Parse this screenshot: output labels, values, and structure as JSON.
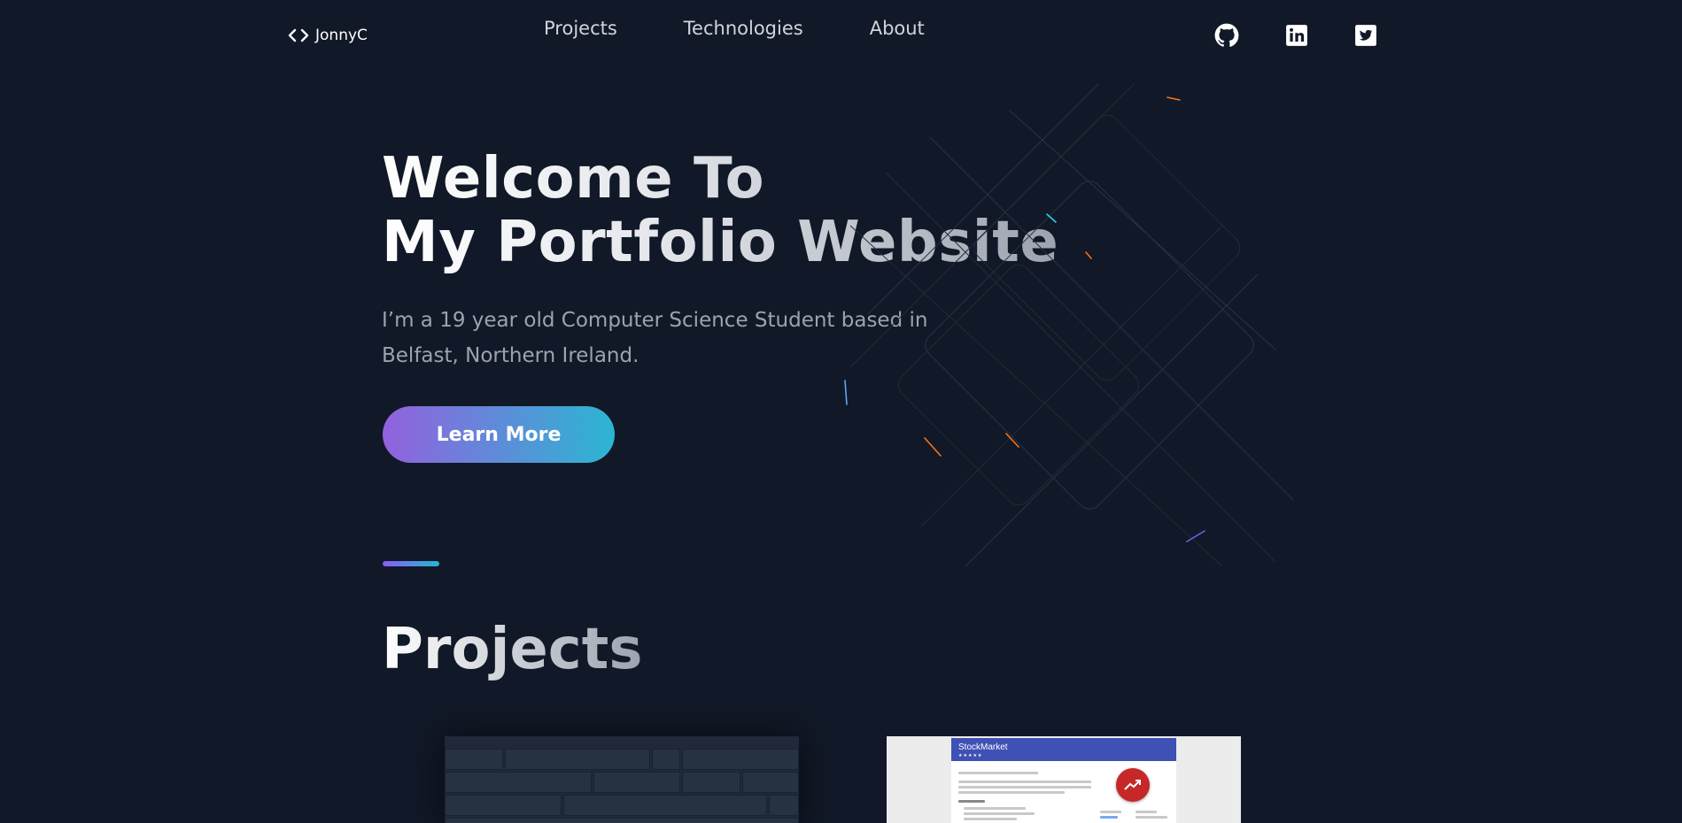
{
  "nav": {
    "logo_text": "JonnyC",
    "links": [
      "Projects",
      "Technologies",
      "About"
    ],
    "social_icons": [
      "github-icon",
      "linkedin-icon",
      "twitter-icon"
    ]
  },
  "hero": {
    "title_line1": "Welcome To",
    "title_line2": "My Portfolio Website",
    "subtitle": "I’m a 19 year old Computer Science Student based in Belfast, Northern Ireland.",
    "button_label": "Learn More"
  },
  "projects": {
    "heading": "Projects",
    "cards": [
      {
        "thumbnail": "keyboard-screenshot"
      },
      {
        "thumbnail": "stockmarket-screenshot",
        "app_title": "StockMarket"
      }
    ]
  },
  "colors": {
    "background": "#111827",
    "accent_start": "#9361de",
    "accent_end": "#2bb6d3"
  }
}
